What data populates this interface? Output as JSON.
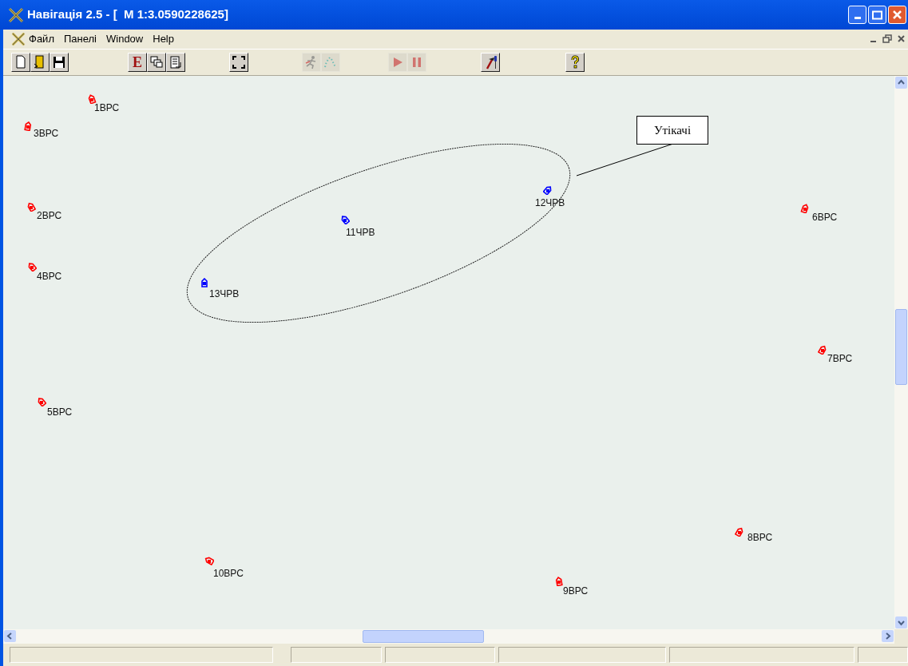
{
  "window": {
    "title": "Навігація 2.5 - [  M 1:3.0590228625]"
  },
  "menu": [
    "Файл",
    "Панелі",
    "Window",
    "Help"
  ],
  "toolbar": [
    {
      "kind": "new",
      "disabled": false
    },
    {
      "kind": "open",
      "disabled": false
    },
    {
      "kind": "save",
      "disabled": false
    },
    {
      "kind": "letter",
      "label": "E",
      "disabled": false
    },
    {
      "kind": "windows",
      "disabled": false
    },
    {
      "kind": "list",
      "disabled": false
    },
    {
      "kind": "fit",
      "disabled": false
    },
    {
      "kind": "runner",
      "disabled": true
    },
    {
      "kind": "dots",
      "disabled": true
    },
    {
      "kind": "play",
      "disabled": true
    },
    {
      "kind": "pause",
      "disabled": true
    },
    {
      "kind": "tools",
      "disabled": false
    },
    {
      "kind": "help",
      "disabled": false
    }
  ],
  "map": {
    "ships": [
      {
        "label": "1ВРС",
        "color": "#ff0000"
      },
      {
        "label": "3ВРС",
        "color": "#ff0000"
      },
      {
        "label": "2ВРС",
        "color": "#ff0000"
      },
      {
        "label": "4ВРС",
        "color": "#ff0000"
      },
      {
        "label": "5ВРС",
        "color": "#ff0000"
      },
      {
        "label": "13ЧРВ",
        "color": "#0000ff"
      },
      {
        "label": "11ЧРВ",
        "color": "#0000ff"
      },
      {
        "label": "12ЧРВ",
        "color": "#0000ff"
      },
      {
        "label": "6ВРС",
        "color": "#ff0000"
      },
      {
        "label": "7ВРС",
        "color": "#ff0000"
      },
      {
        "label": "8ВРС",
        "color": "#ff0000"
      },
      {
        "label": "9ВРС",
        "color": "#ff0000"
      },
      {
        "label": "10ВРС",
        "color": "#ff0000"
      }
    ],
    "callout": "Утікачі"
  }
}
